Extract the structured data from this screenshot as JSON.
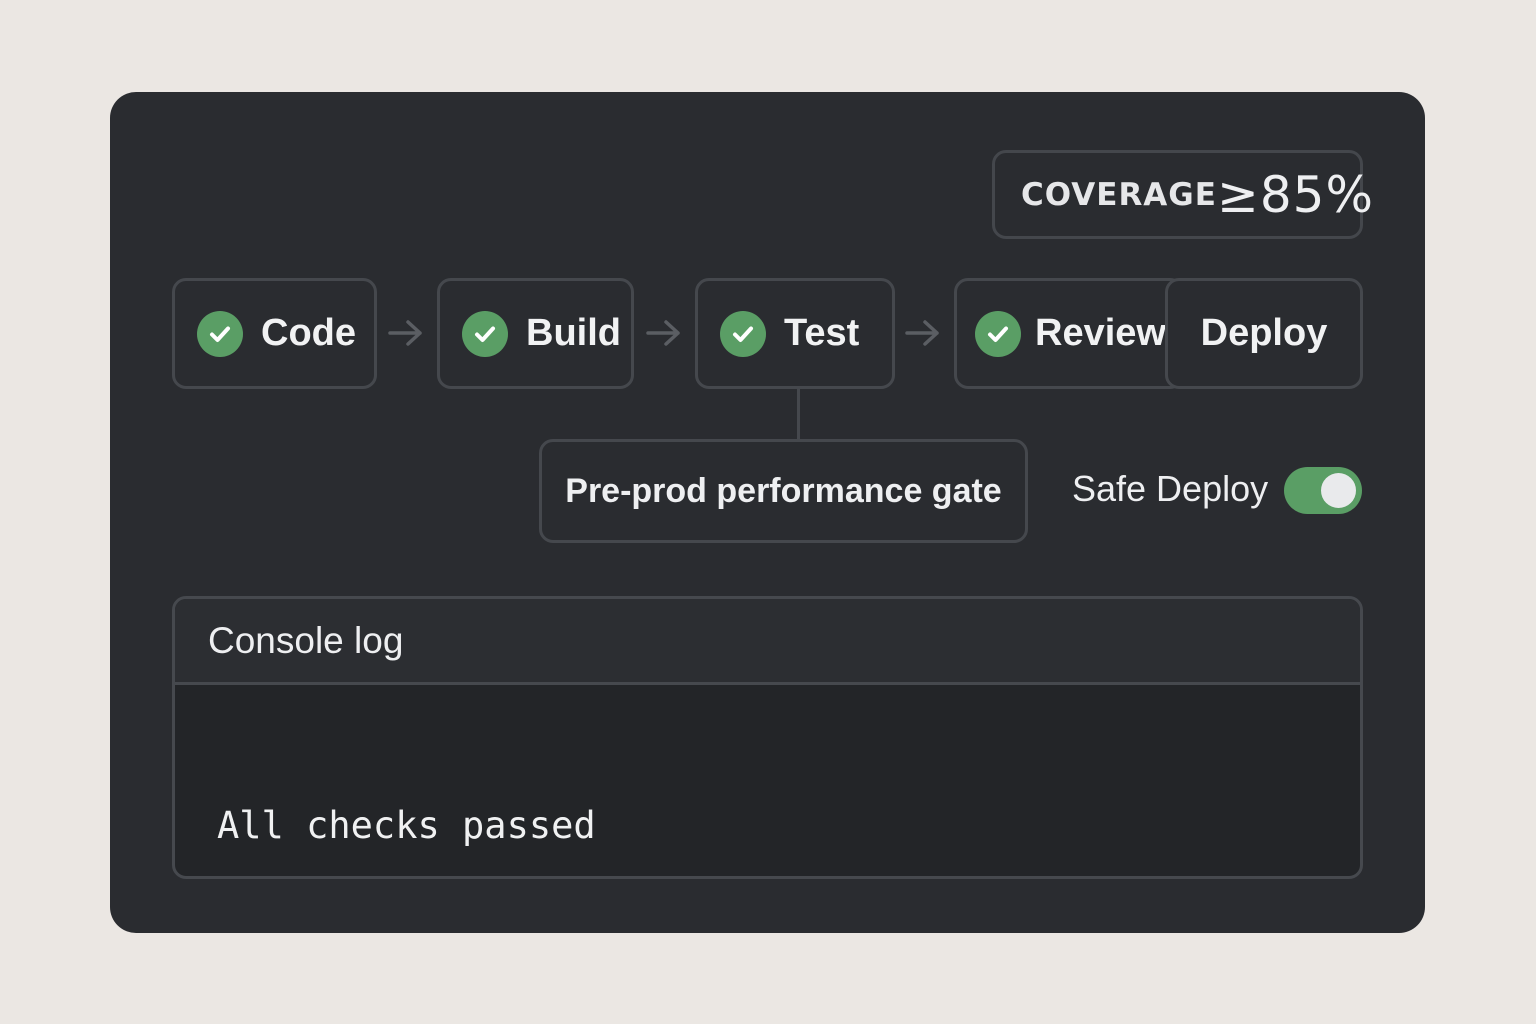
{
  "coverage": {
    "label": "COVERAGE",
    "value": "≥85%"
  },
  "pipeline": {
    "stages": [
      {
        "label": "Code",
        "status": "passed"
      },
      {
        "label": "Build",
        "status": "passed"
      },
      {
        "label": "Test",
        "status": "passed"
      },
      {
        "label": "Review",
        "status": "passed"
      },
      {
        "label": "Deploy",
        "status": "pending"
      }
    ]
  },
  "gate": {
    "label": "Pre-prod performance gate"
  },
  "safe_deploy": {
    "label": "Safe Deploy",
    "enabled": true
  },
  "console": {
    "title": "Console log",
    "lines": [
      "All checks passed"
    ]
  },
  "colors": {
    "background": "#ebe7e3",
    "panel": "#2a2c30",
    "border": "#45484d",
    "success": "#5a9e65",
    "text": "#eeeff1"
  }
}
